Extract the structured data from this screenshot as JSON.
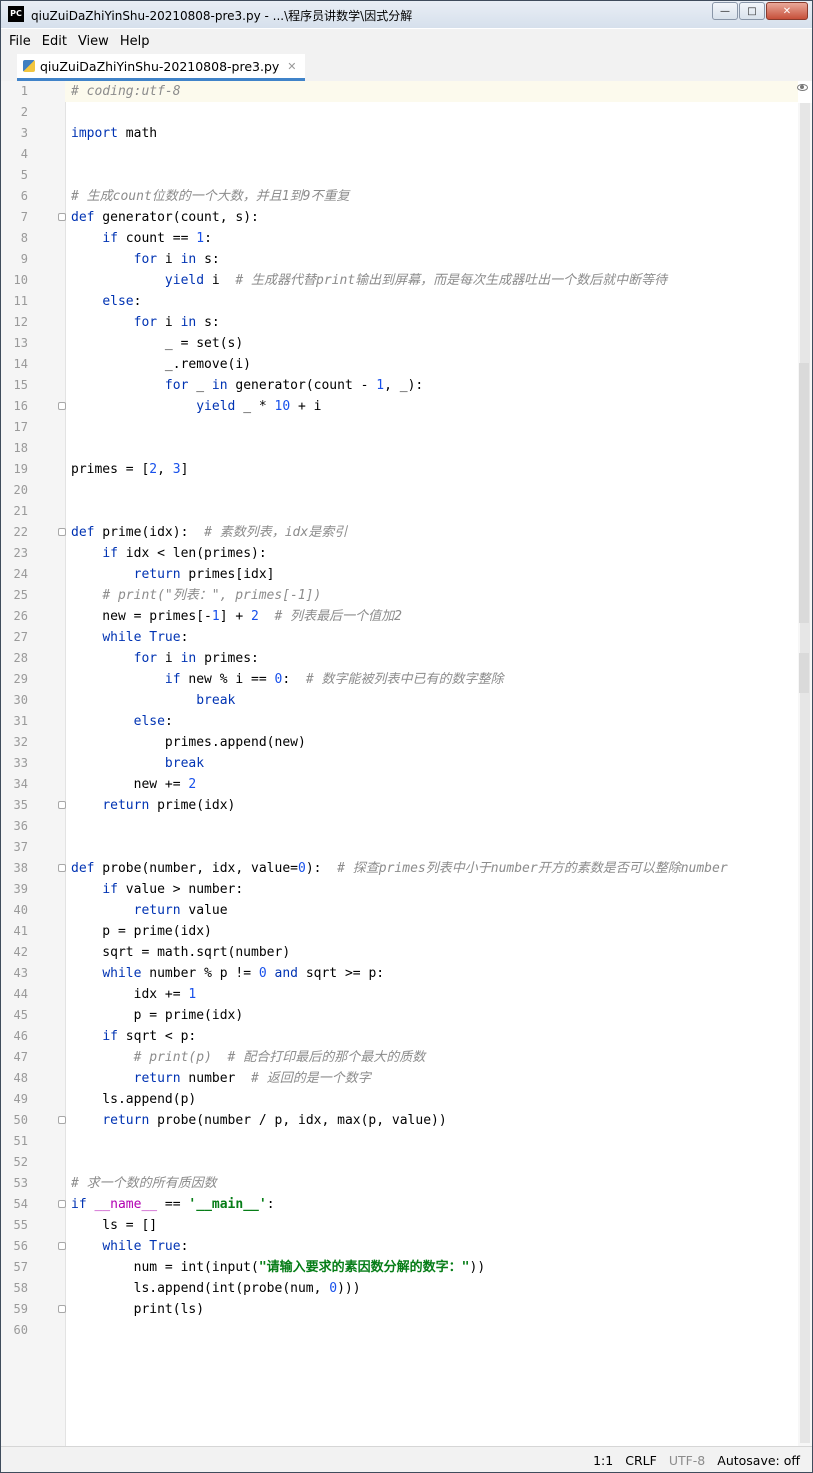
{
  "window": {
    "title": "qiuZuiDaZhiYinShu-20210808-pre3.py - ...\\程序员讲数学\\因式分解",
    "app_icon": "PC"
  },
  "menu": [
    "File",
    "Edit",
    "View",
    "Help"
  ],
  "tab": {
    "label": "qiuZuiDaZhiYinShu-20210808-pre3.py"
  },
  "editor": {
    "lines": [
      {
        "n": "1",
        "tokens": [
          {
            "t": "# coding:utf-8",
            "c": "cm"
          }
        ]
      },
      {
        "n": "2",
        "tokens": []
      },
      {
        "n": "3",
        "tokens": [
          {
            "t": "import",
            "c": "kw"
          },
          {
            "t": " math"
          }
        ]
      },
      {
        "n": "4",
        "tokens": []
      },
      {
        "n": "5",
        "tokens": []
      },
      {
        "n": "6",
        "tokens": [
          {
            "t": "# 生成count位数的一个大数，并且1到9不重复",
            "c": "cm"
          }
        ]
      },
      {
        "n": "7",
        "fold": true,
        "tokens": [
          {
            "t": "def",
            "c": "kw"
          },
          {
            "t": " generator(count, s):"
          }
        ]
      },
      {
        "n": "8",
        "tokens": [
          {
            "t": "    "
          },
          {
            "t": "if",
            "c": "kw"
          },
          {
            "t": " count == "
          },
          {
            "t": "1",
            "c": "num"
          },
          {
            "t": ":"
          }
        ]
      },
      {
        "n": "9",
        "tokens": [
          {
            "t": "        "
          },
          {
            "t": "for",
            "c": "kw"
          },
          {
            "t": " i "
          },
          {
            "t": "in",
            "c": "kw"
          },
          {
            "t": " s:"
          }
        ]
      },
      {
        "n": "10",
        "tokens": [
          {
            "t": "            "
          },
          {
            "t": "yield",
            "c": "kw"
          },
          {
            "t": " i  "
          },
          {
            "t": "# 生成器代替print输出到屏幕，而是每次生成器吐出一个数后就中断等待",
            "c": "cm"
          }
        ]
      },
      {
        "n": "11",
        "tokens": [
          {
            "t": "    "
          },
          {
            "t": "else",
            "c": "kw"
          },
          {
            "t": ":"
          }
        ]
      },
      {
        "n": "12",
        "tokens": [
          {
            "t": "        "
          },
          {
            "t": "for",
            "c": "kw"
          },
          {
            "t": " i "
          },
          {
            "t": "in",
            "c": "kw"
          },
          {
            "t": " s:"
          }
        ]
      },
      {
        "n": "13",
        "tokens": [
          {
            "t": "            _ = set(s)"
          }
        ]
      },
      {
        "n": "14",
        "tokens": [
          {
            "t": "            _.remove(i)"
          }
        ]
      },
      {
        "n": "15",
        "tokens": [
          {
            "t": "            "
          },
          {
            "t": "for",
            "c": "kw"
          },
          {
            "t": " _ "
          },
          {
            "t": "in",
            "c": "kw"
          },
          {
            "t": " generator(count - "
          },
          {
            "t": "1",
            "c": "num"
          },
          {
            "t": ", _):"
          }
        ]
      },
      {
        "n": "16",
        "fold": true,
        "tokens": [
          {
            "t": "                "
          },
          {
            "t": "yield",
            "c": "kw"
          },
          {
            "t": " _ * "
          },
          {
            "t": "10",
            "c": "num"
          },
          {
            "t": " + i"
          }
        ]
      },
      {
        "n": "17",
        "tokens": []
      },
      {
        "n": "18",
        "tokens": []
      },
      {
        "n": "19",
        "tokens": [
          {
            "t": "primes = ["
          },
          {
            "t": "2",
            "c": "num"
          },
          {
            "t": ", "
          },
          {
            "t": "3",
            "c": "num"
          },
          {
            "t": "]"
          }
        ]
      },
      {
        "n": "20",
        "tokens": []
      },
      {
        "n": "21",
        "tokens": []
      },
      {
        "n": "22",
        "fold": true,
        "tokens": [
          {
            "t": "def",
            "c": "kw"
          },
          {
            "t": " prime(idx):  "
          },
          {
            "t": "# 素数列表，idx是索引",
            "c": "cm"
          }
        ]
      },
      {
        "n": "23",
        "tokens": [
          {
            "t": "    "
          },
          {
            "t": "if",
            "c": "kw"
          },
          {
            "t": " idx < len(primes):"
          }
        ]
      },
      {
        "n": "24",
        "tokens": [
          {
            "t": "        "
          },
          {
            "t": "return",
            "c": "kw"
          },
          {
            "t": " primes[idx]"
          }
        ]
      },
      {
        "n": "25",
        "tokens": [
          {
            "t": "    "
          },
          {
            "t": "# print(\"列表：\", primes[-1])",
            "c": "cm"
          }
        ]
      },
      {
        "n": "26",
        "tokens": [
          {
            "t": "    new = primes[-"
          },
          {
            "t": "1",
            "c": "num"
          },
          {
            "t": "] + "
          },
          {
            "t": "2",
            "c": "num"
          },
          {
            "t": "  "
          },
          {
            "t": "# 列表最后一个值加2",
            "c": "cm"
          }
        ]
      },
      {
        "n": "27",
        "tokens": [
          {
            "t": "    "
          },
          {
            "t": "while",
            "c": "kw"
          },
          {
            "t": " "
          },
          {
            "t": "True",
            "c": "kw"
          },
          {
            "t": ":"
          }
        ]
      },
      {
        "n": "28",
        "tokens": [
          {
            "t": "        "
          },
          {
            "t": "for",
            "c": "kw"
          },
          {
            "t": " i "
          },
          {
            "t": "in",
            "c": "kw"
          },
          {
            "t": " primes:"
          }
        ]
      },
      {
        "n": "29",
        "tokens": [
          {
            "t": "            "
          },
          {
            "t": "if",
            "c": "kw"
          },
          {
            "t": " new % i == "
          },
          {
            "t": "0",
            "c": "num"
          },
          {
            "t": ":  "
          },
          {
            "t": "# 数字能被列表中已有的数字整除",
            "c": "cm"
          }
        ]
      },
      {
        "n": "30",
        "tokens": [
          {
            "t": "                "
          },
          {
            "t": "break",
            "c": "kw"
          }
        ]
      },
      {
        "n": "31",
        "tokens": [
          {
            "t": "        "
          },
          {
            "t": "else",
            "c": "kw"
          },
          {
            "t": ":"
          }
        ]
      },
      {
        "n": "32",
        "tokens": [
          {
            "t": "            primes.append(new)"
          }
        ]
      },
      {
        "n": "33",
        "tokens": [
          {
            "t": "            "
          },
          {
            "t": "break",
            "c": "kw"
          }
        ]
      },
      {
        "n": "34",
        "tokens": [
          {
            "t": "        new += "
          },
          {
            "t": "2",
            "c": "num"
          }
        ]
      },
      {
        "n": "35",
        "fold": true,
        "tokens": [
          {
            "t": "    "
          },
          {
            "t": "return",
            "c": "kw"
          },
          {
            "t": " prime(idx)"
          }
        ]
      },
      {
        "n": "36",
        "tokens": []
      },
      {
        "n": "37",
        "tokens": []
      },
      {
        "n": "38",
        "fold": true,
        "tokens": [
          {
            "t": "def",
            "c": "kw"
          },
          {
            "t": " probe(number, idx, value="
          },
          {
            "t": "0",
            "c": "num"
          },
          {
            "t": "):  "
          },
          {
            "t": "# 探查primes列表中小于number开方的素数是否可以整除number",
            "c": "cm"
          }
        ]
      },
      {
        "n": "39",
        "tokens": [
          {
            "t": "    "
          },
          {
            "t": "if",
            "c": "kw"
          },
          {
            "t": " value > number:"
          }
        ]
      },
      {
        "n": "40",
        "tokens": [
          {
            "t": "        "
          },
          {
            "t": "return",
            "c": "kw"
          },
          {
            "t": " value"
          }
        ]
      },
      {
        "n": "41",
        "tokens": [
          {
            "t": "    p = prime(idx)"
          }
        ]
      },
      {
        "n": "42",
        "tokens": [
          {
            "t": "    sqrt = math.sqrt(number)"
          }
        ]
      },
      {
        "n": "43",
        "tokens": [
          {
            "t": "    "
          },
          {
            "t": "while",
            "c": "kw"
          },
          {
            "t": " number % p != "
          },
          {
            "t": "0",
            "c": "num"
          },
          {
            "t": " "
          },
          {
            "t": "and",
            "c": "kw"
          },
          {
            "t": " sqrt >= p:"
          }
        ]
      },
      {
        "n": "44",
        "tokens": [
          {
            "t": "        idx += "
          },
          {
            "t": "1",
            "c": "num"
          }
        ]
      },
      {
        "n": "45",
        "tokens": [
          {
            "t": "        p = prime(idx)"
          }
        ]
      },
      {
        "n": "46",
        "tokens": [
          {
            "t": "    "
          },
          {
            "t": "if",
            "c": "kw"
          },
          {
            "t": " sqrt < p:"
          }
        ]
      },
      {
        "n": "47",
        "tokens": [
          {
            "t": "        "
          },
          {
            "t": "# print(p)  # 配合打印最后的那个最大的质数",
            "c": "cm"
          }
        ]
      },
      {
        "n": "48",
        "tokens": [
          {
            "t": "        "
          },
          {
            "t": "return",
            "c": "kw"
          },
          {
            "t": " number  "
          },
          {
            "t": "# 返回的是一个数字",
            "c": "cm"
          }
        ]
      },
      {
        "n": "49",
        "tokens": [
          {
            "t": "    ls.append(p)"
          }
        ]
      },
      {
        "n": "50",
        "fold": true,
        "tokens": [
          {
            "t": "    "
          },
          {
            "t": "return",
            "c": "kw"
          },
          {
            "t": " probe(number / p, idx, max(p, value))"
          }
        ]
      },
      {
        "n": "51",
        "tokens": []
      },
      {
        "n": "52",
        "tokens": []
      },
      {
        "n": "53",
        "tokens": [
          {
            "t": "# 求一个数的所有质因数",
            "c": "cm"
          }
        ]
      },
      {
        "n": "54",
        "fold": true,
        "tokens": [
          {
            "t": "if",
            "c": "kw"
          },
          {
            "t": " "
          },
          {
            "t": "__name__",
            "c": "dunder"
          },
          {
            "t": " == "
          },
          {
            "t": "'__main__'",
            "c": "str"
          },
          {
            "t": ":"
          }
        ]
      },
      {
        "n": "55",
        "tokens": [
          {
            "t": "    ls = []"
          }
        ]
      },
      {
        "n": "56",
        "fold": true,
        "tokens": [
          {
            "t": "    "
          },
          {
            "t": "while",
            "c": "kw"
          },
          {
            "t": " "
          },
          {
            "t": "True",
            "c": "kw"
          },
          {
            "t": ":"
          }
        ]
      },
      {
        "n": "57",
        "tokens": [
          {
            "t": "        num = int(input("
          },
          {
            "t": "\"请输入要求的素因数分解的数字：\"",
            "c": "str"
          },
          {
            "t": "))"
          }
        ]
      },
      {
        "n": "58",
        "tokens": [
          {
            "t": "        ls.append(int(probe(num, "
          },
          {
            "t": "0",
            "c": "num"
          },
          {
            "t": ")))"
          }
        ]
      },
      {
        "n": "59",
        "fold": true,
        "tokens": [
          {
            "t": "        print(ls)"
          }
        ]
      },
      {
        "n": "60",
        "tokens": []
      }
    ]
  },
  "status": {
    "position": "1:1",
    "line_ending": "CRLF",
    "encoding": "UTF-8",
    "autosave": "Autosave: off"
  },
  "colors": {
    "keyword": "#0033b3",
    "number": "#1750eb",
    "string": "#067d17",
    "comment": "#8c8c8c",
    "tab_underline": "#4083c9"
  }
}
